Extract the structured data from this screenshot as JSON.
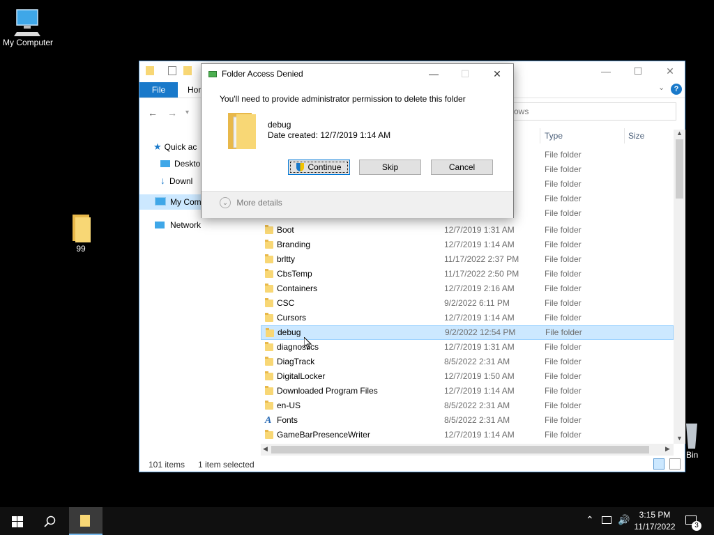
{
  "desktop": {
    "icons": [
      {
        "label": "My Computer"
      },
      {
        "label": "99"
      },
      {
        "label": "Bin"
      }
    ]
  },
  "explorer": {
    "ribbon": {
      "file_tab": "File",
      "home_tab": "Hom"
    },
    "search": {
      "text": "ows"
    },
    "nav_pane": [
      {
        "label": "Quick ac"
      },
      {
        "label": "Deskto"
      },
      {
        "label": "Downl"
      },
      {
        "label": "My Com"
      },
      {
        "label": "Network"
      }
    ],
    "columns": {
      "type": "Type",
      "size": "Size"
    },
    "partial_types": [
      "File folder",
      "File folder",
      "File folder",
      "File folder",
      "File folder"
    ],
    "rows": [
      {
        "name": "Boot",
        "date": "12/7/2019 1:31 AM",
        "type": "File folder",
        "icon": "folder-icon"
      },
      {
        "name": "Branding",
        "date": "12/7/2019 1:14 AM",
        "type": "File folder",
        "icon": "folder-icon"
      },
      {
        "name": "brltty",
        "date": "11/17/2022 2:37 PM",
        "type": "File folder",
        "icon": "folder-icon"
      },
      {
        "name": "CbsTemp",
        "date": "11/17/2022 2:50 PM",
        "type": "File folder",
        "icon": "folder-icon"
      },
      {
        "name": "Containers",
        "date": "12/7/2019 2:16 AM",
        "type": "File folder",
        "icon": "folder-icon"
      },
      {
        "name": "CSC",
        "date": "9/2/2022 6:11 PM",
        "type": "File folder",
        "icon": "folder-icon"
      },
      {
        "name": "Cursors",
        "date": "12/7/2019 1:14 AM",
        "type": "File folder",
        "icon": "folder-icon"
      },
      {
        "name": "debug",
        "date": "9/2/2022 12:54 PM",
        "type": "File folder",
        "icon": "folder-icon",
        "selected": true
      },
      {
        "name": "diagnostics",
        "date": "12/7/2019 1:31 AM",
        "type": "File folder",
        "icon": "folder-icon"
      },
      {
        "name": "DiagTrack",
        "date": "8/5/2022 2:31 AM",
        "type": "File folder",
        "icon": "folder-icon"
      },
      {
        "name": "DigitalLocker",
        "date": "12/7/2019 1:50 AM",
        "type": "File folder",
        "icon": "folder-icon"
      },
      {
        "name": "Downloaded Program Files",
        "date": "12/7/2019 1:14 AM",
        "type": "File folder",
        "icon": "folder-icon"
      },
      {
        "name": "en-US",
        "date": "8/5/2022 2:31 AM",
        "type": "File folder",
        "icon": "folder-icon"
      },
      {
        "name": "Fonts",
        "date": "8/5/2022 2:31 AM",
        "type": "File folder",
        "icon": "fonts-icon"
      },
      {
        "name": "GameBarPresenceWriter",
        "date": "12/7/2019 1:14 AM",
        "type": "File folder",
        "icon": "folder-icon"
      }
    ],
    "status": {
      "items": "101 items",
      "selected": "1 item selected"
    }
  },
  "dialog": {
    "title": "Folder Access Denied",
    "message": "You'll need to provide administrator permission to delete this folder",
    "folder_name": "debug",
    "date_created": "Date created: 12/7/2019 1:14 AM",
    "buttons": {
      "continue": "Continue",
      "skip": "Skip",
      "cancel": "Cancel"
    },
    "more_details": "More details"
  },
  "taskbar": {
    "time": "3:15 PM",
    "date": "11/17/2022",
    "notifications": "3"
  },
  "colors": {
    "accent": "#1979ca",
    "selection": "#cce8ff",
    "folder": "#f8d775"
  }
}
